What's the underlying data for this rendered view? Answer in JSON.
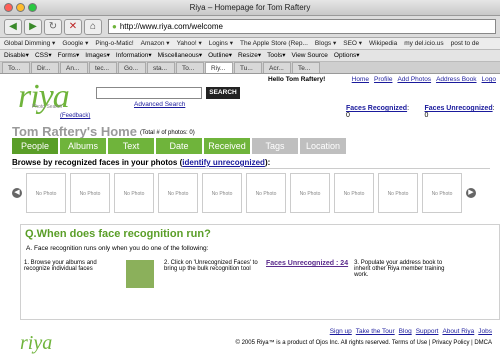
{
  "window": {
    "title": "Riya – Homepage for Tom Raftery"
  },
  "nav": {
    "url": "http://www.riya.com/welcome"
  },
  "bookmarks": [
    "Global Dimming ▾",
    "Google ▾",
    "Ping-o-Matic!",
    "Amazon ▾",
    "Yahoo! ▾",
    "Logins ▾",
    "The Apple Store (Rep...",
    "Blogs ▾",
    "SEO ▾",
    "Wikipedia",
    "my del.icio.us",
    "post to de"
  ],
  "toolbar2": [
    "Disable▾",
    "CSS▾",
    "Forms▾",
    "Images▾",
    "Information▾",
    "Miscellaneous▾",
    "Outline▾",
    "Resize▾",
    "Tools▾",
    "View Source",
    "Options▾"
  ],
  "tabs": [
    "To...",
    "Dir...",
    "An...",
    "tec...",
    "Go...",
    "sta...",
    "To...",
    "Riy...",
    "Tu...",
    "Acr...",
    "Te..."
  ],
  "header": {
    "hello": "Hello Tom Raftery!",
    "links": [
      "Home",
      "Profile",
      "Add Photos",
      "Address Book",
      "Logo"
    ],
    "search_button": "SEARCH",
    "advanced": "Advanced Search",
    "feedback": "(Feedback)",
    "logo": "riya",
    "logo_sub": "Photo Search",
    "faces_recognized": "Faces Recognized",
    "faces_recognized_count": ": 0",
    "faces_unrecognized": "Faces Unrecognized",
    "faces_unrecognized_count": ": 0"
  },
  "main": {
    "title": "Tom Raftery's Home",
    "photo_count": "(Total # of photos: 0)",
    "tabs": [
      "People",
      "Albums",
      "Text",
      "Date",
      "Received",
      "Tags",
      "Location"
    ],
    "browse_text": "Browse by recognized faces in your photos (",
    "browse_link": "identify unrecognized",
    "browse_end": "):",
    "no_photo": "No Photo"
  },
  "faq": {
    "question": "Q.When does face recognition run?",
    "answer": "A. Face recognition runs only when you do one of the following:",
    "step1": "1. Browse your albums and recognize individual faces",
    "step2": "2. Click on 'Unrecognized Faces' to bring up the bulk recognition tool",
    "faces_unrec": "Faces Unrecognized : 24",
    "step3": "3. Populate your address book to inherit other Riya member training work."
  },
  "footer": {
    "links": [
      "Sign up",
      "Take the Tour",
      "Blog",
      "Support",
      "About Riya",
      "Jobs"
    ],
    "copyright": "© 2005 Riya™ is a product of Ojos Inc. All rights reserved. Terms of Use | Privacy Policy | DMCA",
    "logo": "riya"
  },
  "colors": {
    "accent": "#6fb43b",
    "link": "#1a1a9c"
  }
}
